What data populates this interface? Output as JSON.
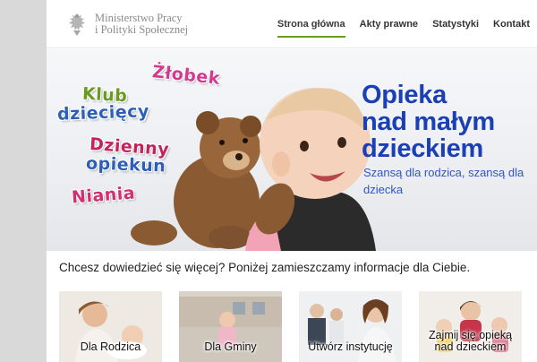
{
  "header": {
    "logo_line1": "Ministerstwo Pracy",
    "logo_line2": "i Polityki Społecznej",
    "nav": [
      {
        "label": "Strona główna",
        "active": true
      },
      {
        "label": "Akty prawne",
        "active": false
      },
      {
        "label": "Statystyki",
        "active": false
      },
      {
        "label": "Kontakt",
        "active": false
      }
    ]
  },
  "hero": {
    "floating_words": [
      "Żłobek",
      "Klub",
      "dziecięcy",
      "Dzienny",
      "opiekun",
      "Niania"
    ],
    "headline_line1": "Opieka",
    "headline_line2": "nad małym",
    "headline_line3": "dzieckiem",
    "subline": "Szansą dla rodzica, szansą dla dziecka"
  },
  "intro": "Chcesz dowiedzieć się więcej?  Poniżej zamieszczamy informacje dla Ciebie.",
  "cards": [
    {
      "label": "Dla Rodzica"
    },
    {
      "label": "Dla Gminy"
    },
    {
      "label": "Utwórz instytucję"
    },
    {
      "label_line1": "Zajmij się opieką",
      "label_line2": "nad dzieckiem"
    }
  ],
  "colors": {
    "nav_active_underline": "#6b9e1f",
    "headline": "#1b3fb5",
    "subline": "#2f55c8"
  }
}
